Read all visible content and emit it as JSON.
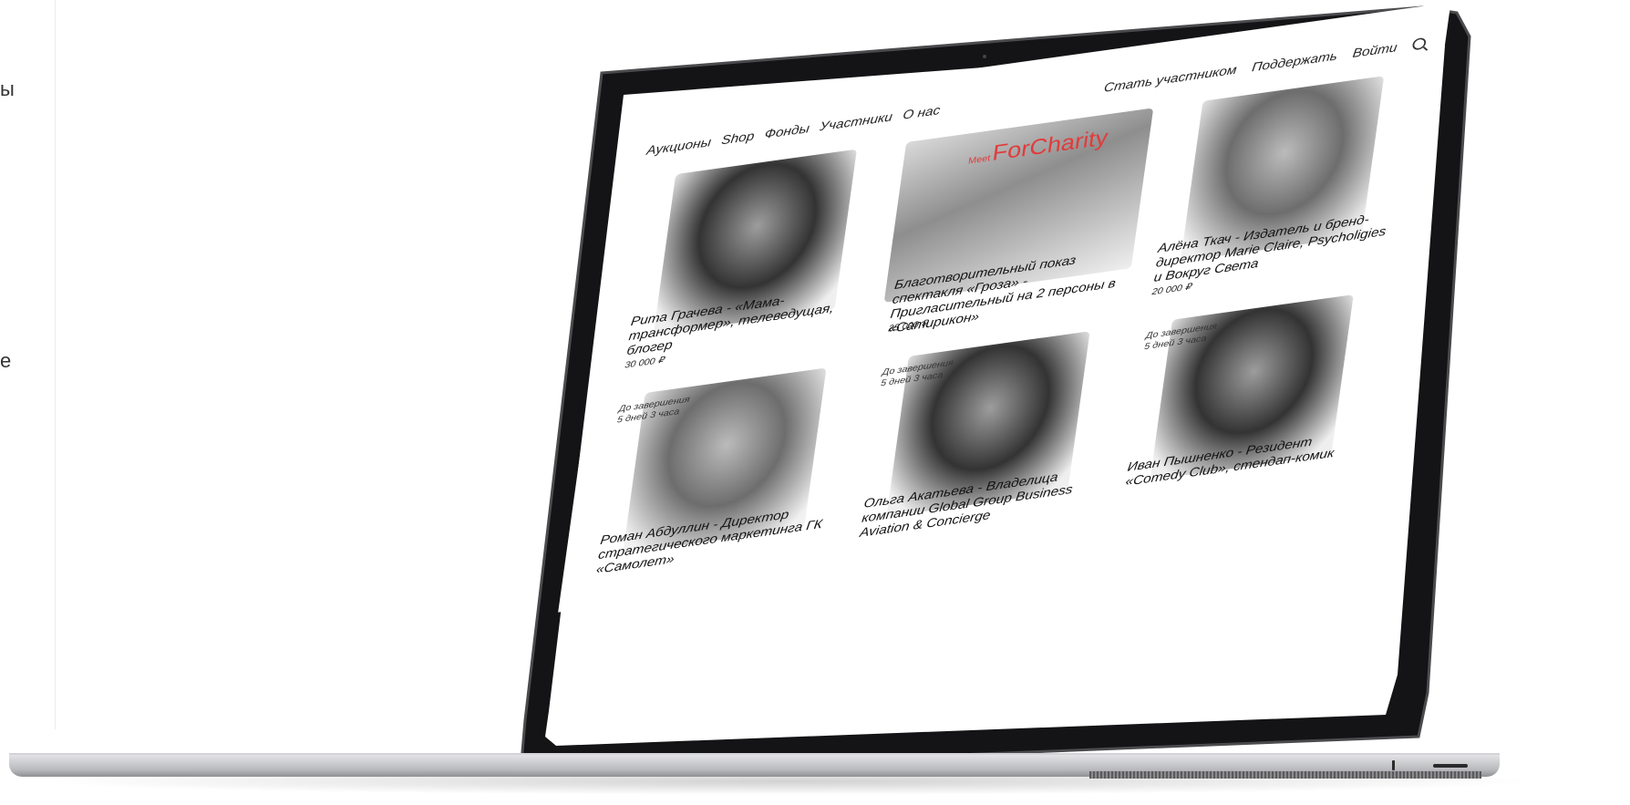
{
  "edge": {
    "left_text_1": "ы",
    "left_text_2": "е"
  },
  "nav": {
    "left_items": [
      {
        "label": "Аукционы"
      },
      {
        "label": "Shop"
      },
      {
        "label": "Фонды"
      },
      {
        "label": "Участники"
      },
      {
        "label": "О нас"
      }
    ],
    "right_items": {
      "join": "Стать участником",
      "support": "Поддержать",
      "login": "Войти"
    },
    "search_icon": "search-icon"
  },
  "brand": {
    "prefix": "Meet",
    "name": "ForCharity"
  },
  "cards": [
    {
      "caption": "Рита Грачева - «Мама-трансформер», телеведущая, блогер",
      "price": "30 000 ₽",
      "timer_label": "",
      "timer_value": ""
    },
    {
      "caption": "Благотворительный показ спектакля «Гроза» - Пригласительный на 2 персоны в «Сатирикон»",
      "price": "25 000 ₽",
      "timer_label": "",
      "timer_value": ""
    },
    {
      "caption": "Алёна Ткач - Издатель и бренд-директор Marie Claire, Psycholigies и Вокруг Света",
      "price": "20 000 ₽",
      "timer_label": "",
      "timer_value": ""
    },
    {
      "caption": "Роман Абдуллин - Директор стратегического маркетинга ГК «Самолет»",
      "price": "",
      "timer_label": "До завершения",
      "timer_value": "5 дней 3 часа"
    },
    {
      "caption": "Ольга Акатьева - Владелица компании Global Group Business Aviation & Concierge",
      "price": "",
      "timer_label": "До завершения",
      "timer_value": "5 дней 3 часа"
    },
    {
      "caption": "Иван Пышненко - Резидент «Comedy Club», стендап-комик",
      "price": "",
      "timer_label": "До завершения",
      "timer_value": "5 дней 3 часа"
    }
  ],
  "colors": {
    "brand": "#e23b3b",
    "bezel": "#1a1a1c",
    "base": "#c7c8cb"
  }
}
